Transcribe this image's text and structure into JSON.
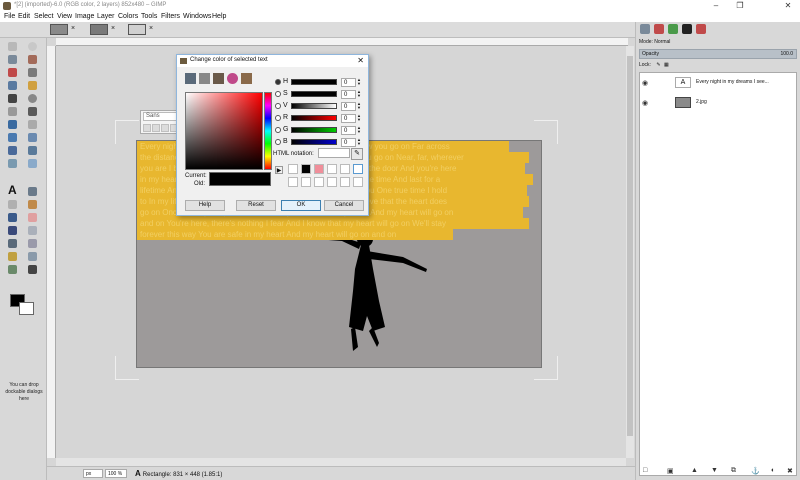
{
  "window": {
    "title": "*[2] (imported)-6.0 (RGB color, 2 layers) 852x480 – GIMP",
    "min_icon": "minimize-icon",
    "max_icon": "maximize-icon",
    "close_icon": "close-icon"
  },
  "menu": [
    "File",
    "Edit",
    "Select",
    "View",
    "Image",
    "Layer",
    "Colors",
    "Tools",
    "Filters",
    "Windows",
    "Help"
  ],
  "image_tabs": [
    {
      "close": "×"
    },
    {
      "close": "×"
    },
    {
      "close": "×"
    }
  ],
  "toolbox": {
    "hint": "You can drop dockable dialogs here",
    "fg_color": "#000000",
    "bg_color": "#ffffff"
  },
  "canvas": {
    "text_lines": [
      "Every night in my dreams I see you, I feel you, That is how I know you go on Far across",
      "the distance And spaces between us You have come to show you go on Near, far, wherever",
      "you are I believe that the heart does go on Once more you open the door And you're here",
      "in my heart And my heart will go on and on Love can touch us one time And last for a",
      "lifetime And never let go till we're gone Love was when I loved you One true time I hold",
      "to In my life we'll always go on Near, far, wherever you are I believe that the heart does",
      "go on Once more you open the door And you're here in my heart And my heart will go on",
      "and on You're here, there's nothing I fear And I know that my heart will go on We'll stay",
      "forever this way You are safe in my heart And my heart will go on and on"
    ],
    "highlight_color": "#e8b72f"
  },
  "font_popup": {
    "font": "Sans"
  },
  "dialog": {
    "title": "Change color of selected text",
    "channels": [
      {
        "key": "H",
        "value": "0",
        "selected": true
      },
      {
        "key": "S",
        "value": "0",
        "selected": false
      },
      {
        "key": "V",
        "value": "0",
        "selected": false
      },
      {
        "key": "R",
        "value": "0",
        "selected": false
      },
      {
        "key": "G",
        "value": "0",
        "selected": false
      },
      {
        "key": "B",
        "value": "0",
        "selected": false
      }
    ],
    "html_notation_label": "HTML notation:",
    "html_notation_value": "",
    "current_label": "Current:",
    "old_label": "Old:",
    "history_colors": [
      "#ffffff",
      "#000000",
      "#f08e9a",
      "#ffffff",
      "#ffffff",
      "#ffffff",
      "#ffffff"
    ],
    "buttons": {
      "help": "Help",
      "reset": "Reset",
      "ok": "OK",
      "cancel": "Cancel"
    }
  },
  "statusbar": {
    "unit": "px",
    "zoom": "100 %",
    "message": "Rectangle: 831 × 448  (1.85:1)"
  },
  "layers_panel": {
    "mode_label": "Mode: Normal",
    "opacity_label": "Opacity",
    "opacity_value": "100.0",
    "lock_label": "Lock:",
    "layers": [
      {
        "name": "Every night in my dreams I see..."
      },
      {
        "name": "2.jpg"
      }
    ]
  }
}
